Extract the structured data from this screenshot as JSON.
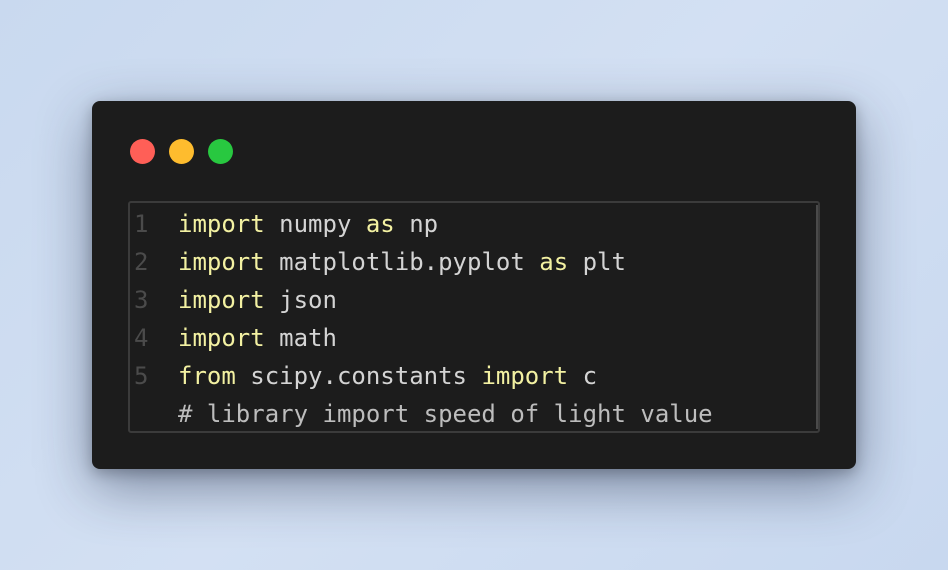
{
  "colors": {
    "background": "#cfdcf1",
    "window": "#1c1c1c",
    "close_dot": "#ff5f57",
    "minimize_dot": "#febc2e",
    "maximize_dot": "#28c840",
    "keyword": "#f3f1a2",
    "text": "#d4d4d4",
    "line_number": "#4b4b4b"
  },
  "window": {
    "controls": [
      "close-dot",
      "minimize-dot",
      "maximize-dot"
    ]
  },
  "code": {
    "lines": [
      {
        "number": "1",
        "tokens": [
          {
            "t": "import",
            "kw": true
          },
          {
            "t": " numpy ",
            "kw": false
          },
          {
            "t": "as",
            "kw": true
          },
          {
            "t": " np",
            "kw": false
          }
        ]
      },
      {
        "number": "2",
        "tokens": [
          {
            "t": "import",
            "kw": true
          },
          {
            "t": " matplotlib.pyplot ",
            "kw": false
          },
          {
            "t": "as",
            "kw": true
          },
          {
            "t": " plt",
            "kw": false
          }
        ]
      },
      {
        "number": "3",
        "tokens": [
          {
            "t": "import",
            "kw": true
          },
          {
            "t": " json",
            "kw": false
          }
        ]
      },
      {
        "number": "4",
        "tokens": [
          {
            "t": "import",
            "kw": true
          },
          {
            "t": " math",
            "kw": false
          }
        ]
      },
      {
        "number": "5",
        "tokens": [
          {
            "t": "from",
            "kw": true
          },
          {
            "t": " scipy.constants ",
            "kw": false
          },
          {
            "t": "import",
            "kw": true
          },
          {
            "t": " c",
            "kw": false
          }
        ]
      },
      {
        "number": "",
        "comment": true,
        "tokens": [
          {
            "t": "# library import speed of light value",
            "kw": false
          }
        ]
      }
    ]
  }
}
